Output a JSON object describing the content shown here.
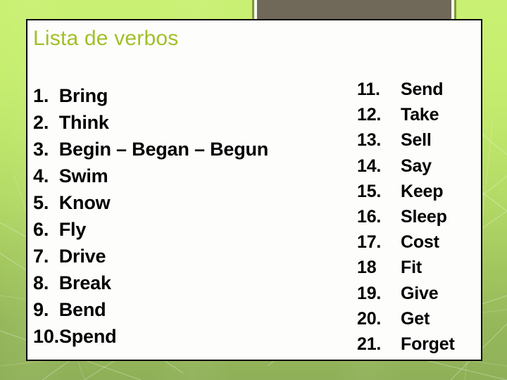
{
  "slide": {
    "title": "Lista de verbos",
    "title_color": "#a0c028",
    "background_top_color": "#c9f072",
    "background_bottom_color": "#8fb058",
    "panel_background": "#fdfdfb",
    "panel_border_color": "#000000",
    "banner_brown_color": "#706858",
    "banner_border_color": "#7d9a36"
  },
  "left_column": {
    "items": [
      {
        "number": "1.",
        "word": "Bring"
      },
      {
        "number": "2.",
        "word": "Think"
      },
      {
        "number": "3.",
        "word": "Begin – Began – Begun"
      },
      {
        "number": "4.",
        "word": "Swim"
      },
      {
        "number": "5.",
        "word": "Know"
      },
      {
        "number": "6.",
        "word": "Fly"
      },
      {
        "number": "7.",
        "word": "Drive"
      },
      {
        "number": "8.",
        "word": "Break"
      },
      {
        "number": "9.",
        "word": "Bend"
      },
      {
        "number": "10.",
        "word": "Spend"
      }
    ]
  },
  "right_column": {
    "items": [
      {
        "number": "11.",
        "word": "Send"
      },
      {
        "number": "12.",
        "word": "Take"
      },
      {
        "number": "13.",
        "word": "Sell"
      },
      {
        "number": "14.",
        "word": "Say"
      },
      {
        "number": "15.",
        "word": "Keep"
      },
      {
        "number": "16.",
        "word": "Sleep"
      },
      {
        "number": "17.",
        "word": "Cost"
      },
      {
        "number": "18",
        "word": "Fit"
      },
      {
        "number": "19.",
        "word": "Give"
      },
      {
        "number": "20.",
        "word": "Get"
      },
      {
        "number": "21.",
        "word": "Forget"
      }
    ]
  }
}
